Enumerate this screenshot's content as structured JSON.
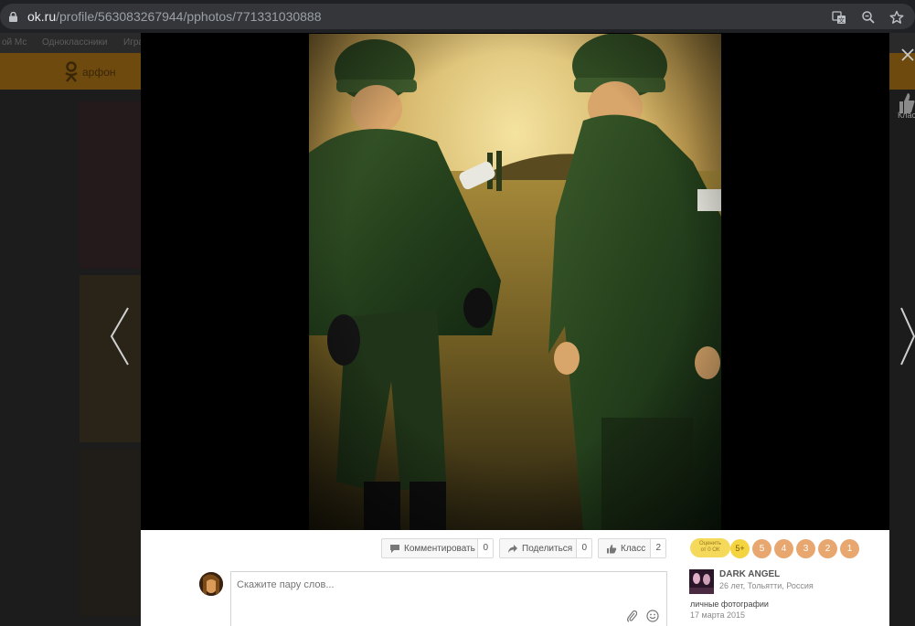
{
  "browser": {
    "url_host": "ok.ru",
    "url_path": "/profile/563083267944/pphotos/771331030888"
  },
  "background": {
    "bookmarks": [
      "ой Мс",
      "Одноклассники",
      "Игра"
    ],
    "header_text": "арфон"
  },
  "viewer": {
    "side_like_label": "Клас"
  },
  "actions": {
    "comment_label": "Комментировать",
    "comment_count": "0",
    "share_label": "Поделиться",
    "share_count": "0",
    "like_label": "Класс",
    "like_count": "2"
  },
  "comment": {
    "placeholder": "Скажите пару слов..."
  },
  "rating": {
    "badge_line1": "Оценить",
    "badge_line2": "от 0 ОК",
    "options": [
      "5+",
      "5",
      "4",
      "3",
      "2",
      "1"
    ]
  },
  "author": {
    "name": "DARK ANGEL",
    "info": "26 лет, Тольятти, Россия",
    "album": "личные фотографии",
    "date": "17 марта 2015"
  },
  "colors": {
    "ok_orange": "#e8a76e",
    "rate_gold": "#f5d442"
  }
}
